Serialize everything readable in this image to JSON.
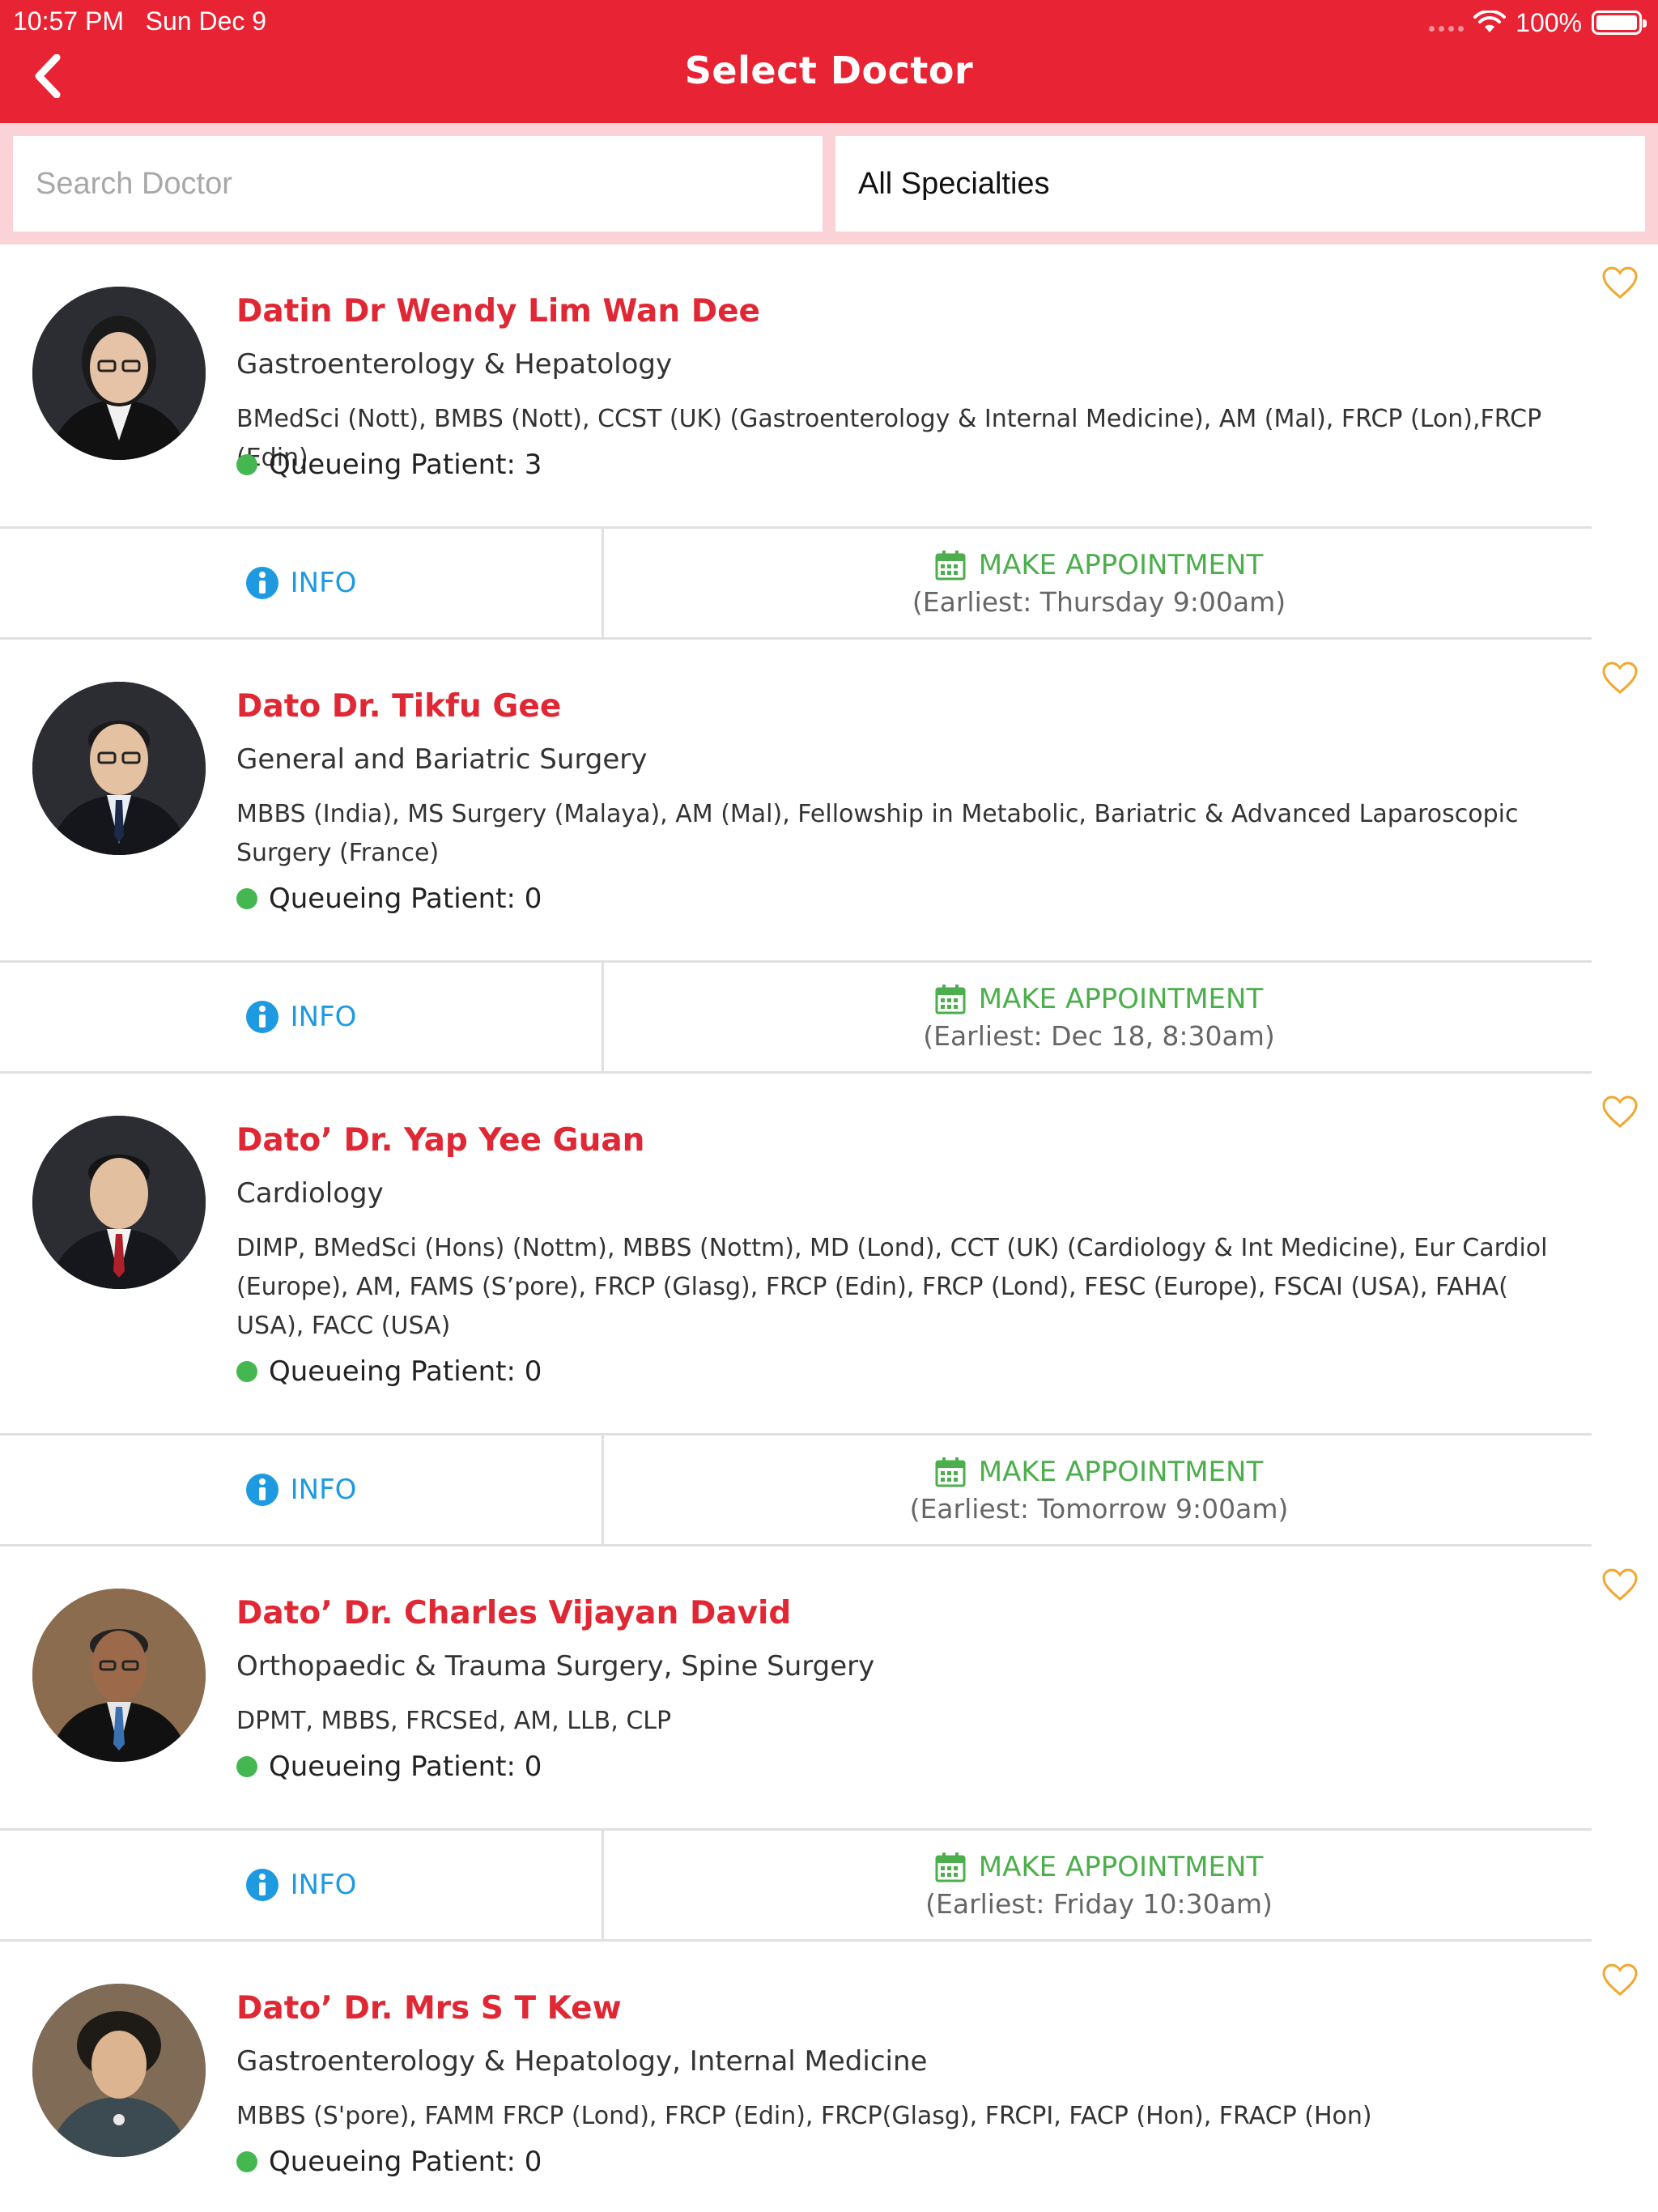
{
  "status_bar": {
    "time": "10:57 PM",
    "date": "Sun Dec 9",
    "battery": "100%"
  },
  "nav": {
    "title": "Select Doctor",
    "back_icon": "chevron-left-icon"
  },
  "search": {
    "placeholder": "Search Doctor",
    "specialty": "All Specialties"
  },
  "colors": {
    "brand": "#e82333",
    "name": "#e02835",
    "info": "#1e9ae0",
    "appointment": "#4cae4c",
    "queue_dot": "#45b750",
    "favorite": "#f0a830"
  },
  "doctors": [
    {
      "name": "Datin Dr Wendy Lim Wan Dee",
      "specialty": "Gastroenterology & Hepatology",
      "qualifications": "BMedSci (Nott), BMBS (Nott), CCST (UK) (Gastroenterology & Internal Medicine), AM (Mal), FRCP (Lon),FRCP (Edin)",
      "queue": "Queueing Patient: 3",
      "info_label": "INFO",
      "appointment_label": "MAKE APPOINTMENT",
      "earliest": "(Earliest: Thursday 9:00am)"
    },
    {
      "name": "Dato Dr. Tikfu Gee",
      "specialty": "General and Bariatric Surgery",
      "qualifications": "MBBS (India), MS Surgery (Malaya), AM (Mal), Fellowship in Metabolic, Bariatric & Advanced Laparoscopic Surgery (France)",
      "queue": "Queueing Patient: 0",
      "info_label": "INFO",
      "appointment_label": "MAKE APPOINTMENT",
      "earliest": "(Earliest: Dec 18, 8:30am)"
    },
    {
      "name": "Dato’ Dr. Yap Yee Guan",
      "specialty": "Cardiology",
      "qualifications": "DIMP, BMedSci (Hons) (Nottm), MBBS (Nottm), MD (Lond), CCT (UK) (Cardiology & Int Medicine), Eur Cardiol (Europe), AM, FAMS (S’pore), FRCP (Glasg), FRCP (Edin), FRCP (Lond), FESC (Europe), FSCAI (USA), FAHA( USA), FACC (USA)",
      "queue": "Queueing Patient: 0",
      "info_label": "INFO",
      "appointment_label": "MAKE APPOINTMENT",
      "earliest": "(Earliest: Tomorrow 9:00am)"
    },
    {
      "name": "Dato’ Dr. Charles Vijayan David",
      "specialty": "Orthopaedic & Trauma Surgery, Spine Surgery",
      "qualifications": "DPMT, MBBS, FRCSEd, AM, LLB, CLP",
      "queue": "Queueing Patient: 0",
      "info_label": "INFO",
      "appointment_label": "MAKE APPOINTMENT",
      "earliest": "(Earliest: Friday 10:30am)"
    },
    {
      "name": "Dato’ Dr. Mrs S T Kew",
      "specialty": "Gastroenterology & Hepatology, Internal Medicine",
      "qualifications": "MBBS (S'pore), FAMM FRCP (Lond), FRCP (Edin), FRCP(Glasg), FRCPI, FACP (Hon), FRACP (Hon)",
      "queue": "Queueing Patient: 0"
    }
  ]
}
